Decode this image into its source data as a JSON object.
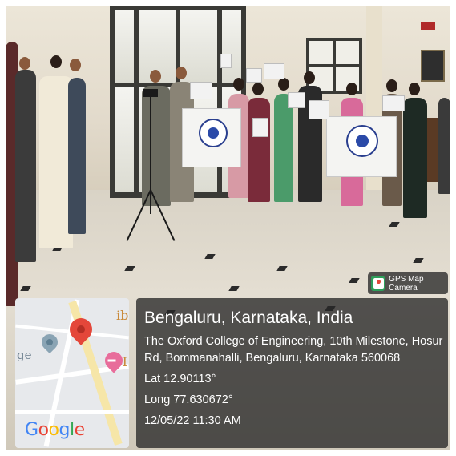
{
  "badge": {
    "label": "GPS Map Camera"
  },
  "map": {
    "brand": "Google",
    "fragment_left": "ge",
    "fragment_top": "ib",
    "fragment_bottom": "H"
  },
  "info": {
    "location": "Bengaluru, Karnataka, India",
    "address_line1": "The Oxford College of Engineering, 10th Milestone, Hosur",
    "address_line2": "Rd, Bommanahalli, Bengaluru, Karnataka 560068",
    "latitude": "Lat 12.90113°",
    "longitude": "Long 77.630672°",
    "datetime": "12/05/22 11:30 AM"
  },
  "colors": {
    "google_blue": "#4285F4",
    "google_red": "#EA4335",
    "google_yellow": "#FBBC05",
    "google_green": "#34A853"
  }
}
